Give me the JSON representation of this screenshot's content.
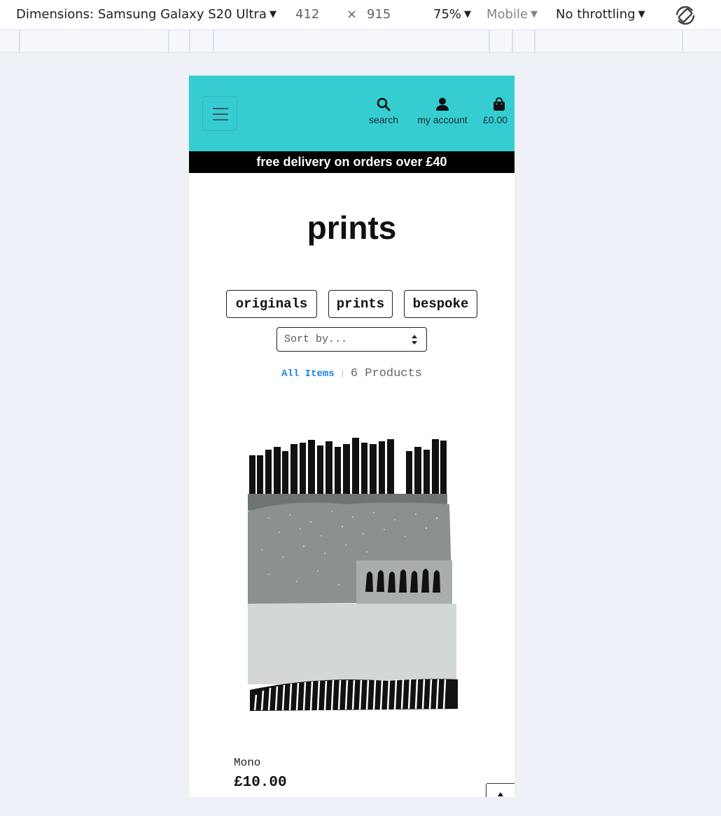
{
  "devtools": {
    "dimensions_label": "Dimensions: Samsung Galaxy S20 Ultra",
    "width": "412",
    "times": "×",
    "height": "915",
    "zoom": "75%",
    "device_type": "Mobile",
    "throttling": "No throttling",
    "caret": "▼"
  },
  "header": {
    "nav": [
      {
        "label": "search",
        "icon": "search-icon"
      },
      {
        "label": "my account",
        "icon": "user-icon"
      },
      {
        "label": "£0.00",
        "icon": "shopping-bag-icon"
      }
    ],
    "brand_color": "#35cdd1"
  },
  "banner": {
    "text": "free delivery on orders over £40"
  },
  "main": {
    "title": "prints",
    "categories": [
      "originals",
      "prints",
      "bespoke"
    ],
    "sort": {
      "selected": "Sort by..."
    },
    "all_items_link": "All Items",
    "separator": "|",
    "product_count": "6 Products"
  },
  "product": {
    "name": "Mono",
    "price": "£10.00"
  }
}
